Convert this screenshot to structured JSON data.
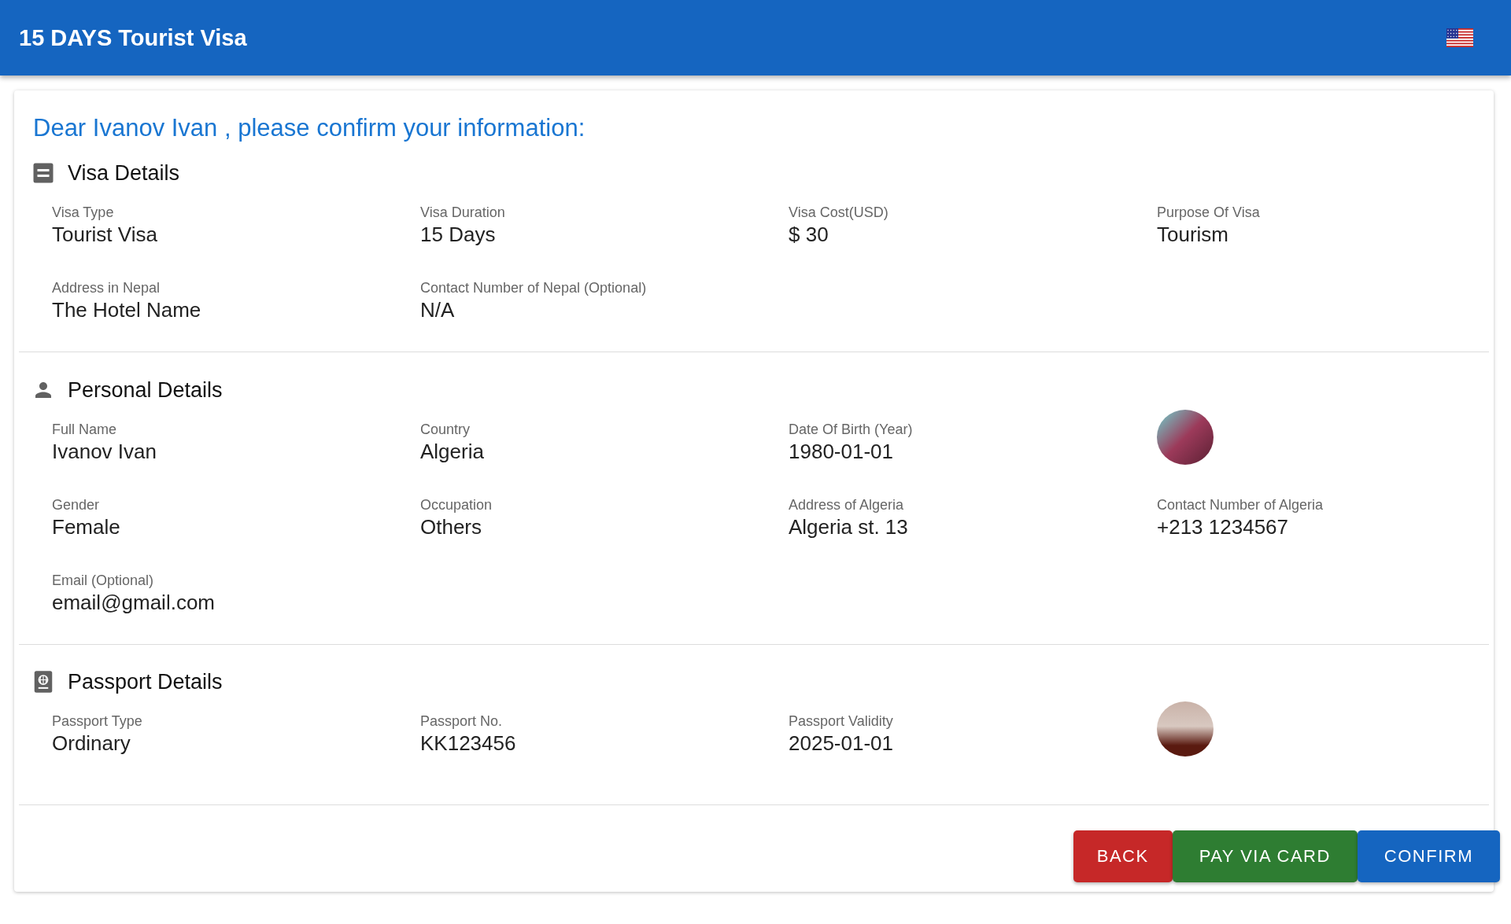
{
  "header": {
    "title": "15 DAYS Tourist Visa"
  },
  "greeting": "Dear Ivanov Ivan , please confirm your information:",
  "sections": [
    {
      "kind": "visa",
      "title": "Visa Details",
      "fields": [
        {
          "kind": "text",
          "label": "Visa Type",
          "value": "Tourist Visa"
        },
        {
          "kind": "text",
          "label": "Visa Duration",
          "value": "15 Days"
        },
        {
          "kind": "text",
          "label": "Visa Cost(USD)",
          "value": "$ 30"
        },
        {
          "kind": "text",
          "label": "Purpose Of Visa",
          "value": "Tourism"
        },
        {
          "kind": "text",
          "label": "Address in Nepal",
          "value": "The Hotel Name"
        },
        {
          "kind": "text",
          "label": "Contact Number of Nepal (Optional)",
          "value": "N/A"
        }
      ]
    },
    {
      "kind": "person",
      "title": "Personal Details",
      "fields": [
        {
          "kind": "text",
          "label": "Full Name",
          "value": "Ivanov Ivan"
        },
        {
          "kind": "text",
          "label": "Country",
          "value": "Algeria"
        },
        {
          "kind": "text",
          "label": "Date Of Birth (Year)",
          "value": "1980-01-01"
        },
        {
          "kind": "photo"
        },
        {
          "kind": "text",
          "label": "Gender",
          "value": "Female"
        },
        {
          "kind": "text",
          "label": "Occupation",
          "value": "Others"
        },
        {
          "kind": "text",
          "label": "Address of Algeria",
          "value": "Algeria st. 13"
        },
        {
          "kind": "text",
          "label": "Contact Number of Algeria",
          "value": "+213 1234567"
        },
        {
          "kind": "text",
          "label": "Email (Optional)",
          "value": "email@gmail.com"
        }
      ]
    },
    {
      "kind": "passport",
      "title": "Passport Details",
      "fields": [
        {
          "kind": "text",
          "label": "Passport Type",
          "value": "Ordinary"
        },
        {
          "kind": "text",
          "label": "Passport No.",
          "value": "KK123456"
        },
        {
          "kind": "text",
          "label": "Passport Validity",
          "value": "2025-01-01"
        },
        {
          "kind": "photo"
        }
      ]
    }
  ],
  "buttons": [
    {
      "label": "BACK",
      "color": "#c62828"
    },
    {
      "label": "PAY VIA CARD",
      "color": "#2e7d32"
    },
    {
      "label": "CONFIRM",
      "color": "#1565c0"
    }
  ]
}
